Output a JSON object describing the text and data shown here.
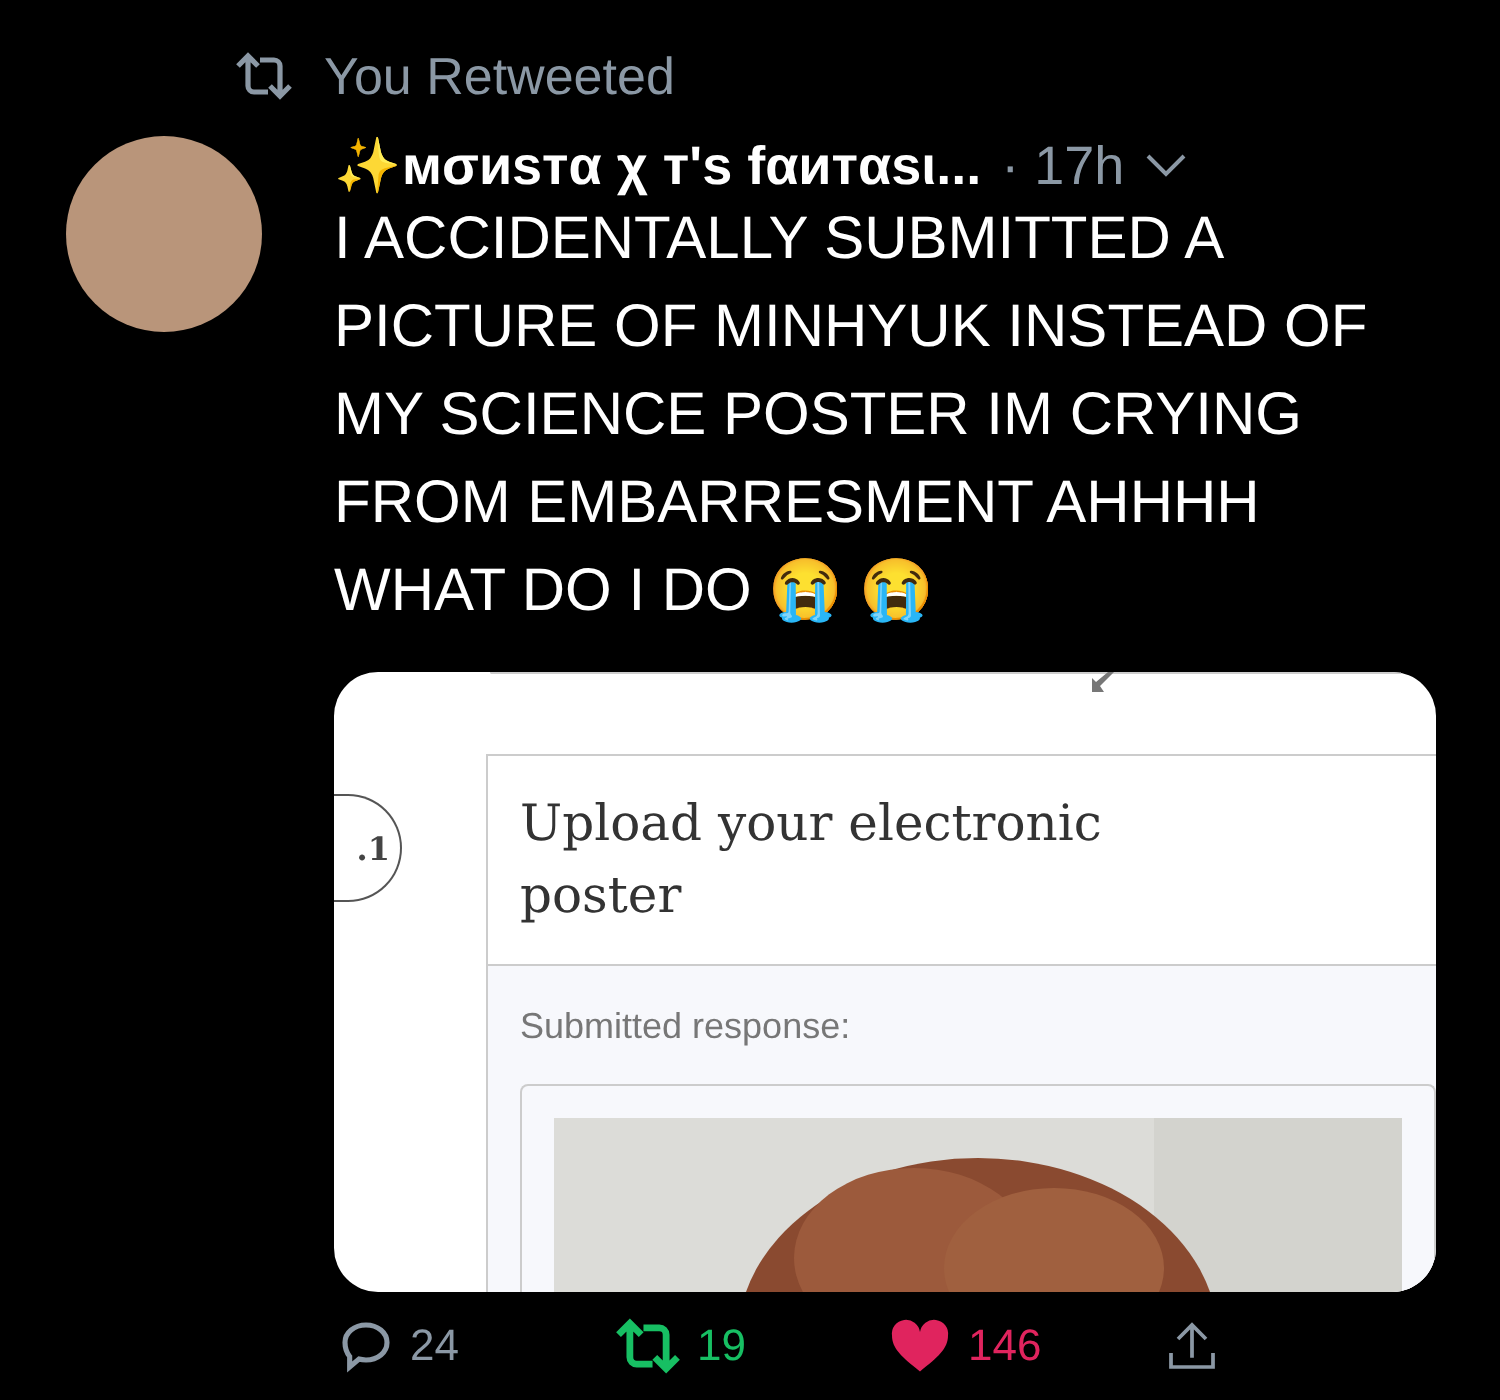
{
  "context": {
    "label": "You Retweeted"
  },
  "tweet": {
    "author": "✨мσиѕтα χ т's fαитαѕι...",
    "time": "· 17h",
    "text": "I ACCIDENTALLY SUBMITTED A PICTURE OF MINHYUK INSTEAD OF MY SCIENCE POSTER IM CRYING FROM EMBARRESMENT AHHHH WHAT DO I DO 😭 😭"
  },
  "attachment": {
    "question_number": ".1",
    "question": "Upload your electronic poster",
    "response_label": "Submitted response:"
  },
  "actions": [
    {
      "kind": "reply",
      "count": "24",
      "active": false
    },
    {
      "kind": "retweet",
      "count": "19",
      "active": true
    },
    {
      "kind": "like",
      "count": "146",
      "active": true
    },
    {
      "kind": "share",
      "active": false
    }
  ]
}
